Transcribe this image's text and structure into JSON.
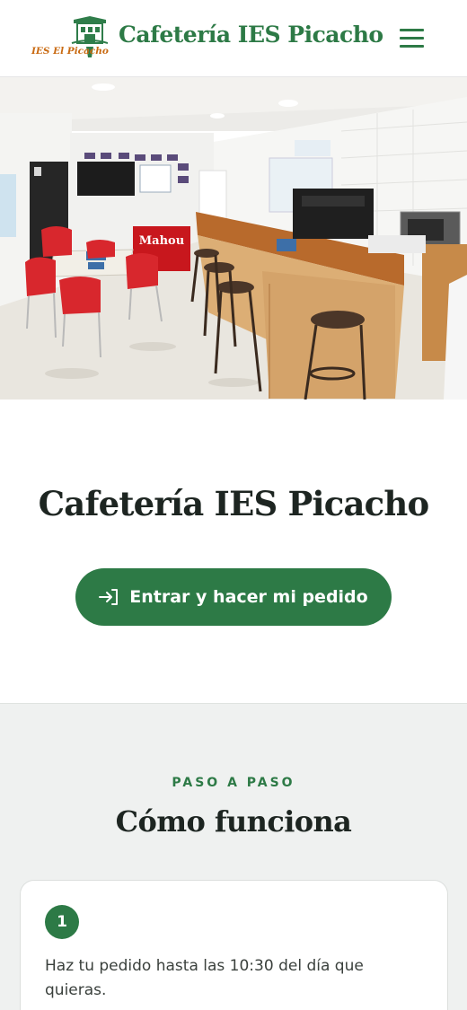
{
  "header": {
    "logo_text": "IES El Picacho",
    "title": "Cafetería IES Picacho",
    "menu_icon": "hamburger-icon"
  },
  "hero": {
    "image": "cafeteria-interior-photo",
    "sign_text": "Mahou"
  },
  "welcome": {
    "title": "Cafetería IES Picacho",
    "cta_label": "Entrar y hacer mi pedido",
    "cta_icon": "login-icon"
  },
  "how_it_works": {
    "eyebrow": "PASO A PASO",
    "title": "Cómo funciona",
    "steps": [
      {
        "number": "1",
        "text": "Haz tu pedido hasta las 10:30 del día que quieras."
      }
    ]
  },
  "colors": {
    "brand_green": "#2d7a46",
    "logo_orange": "#c96a12",
    "section_bg": "#eff1f0"
  }
}
